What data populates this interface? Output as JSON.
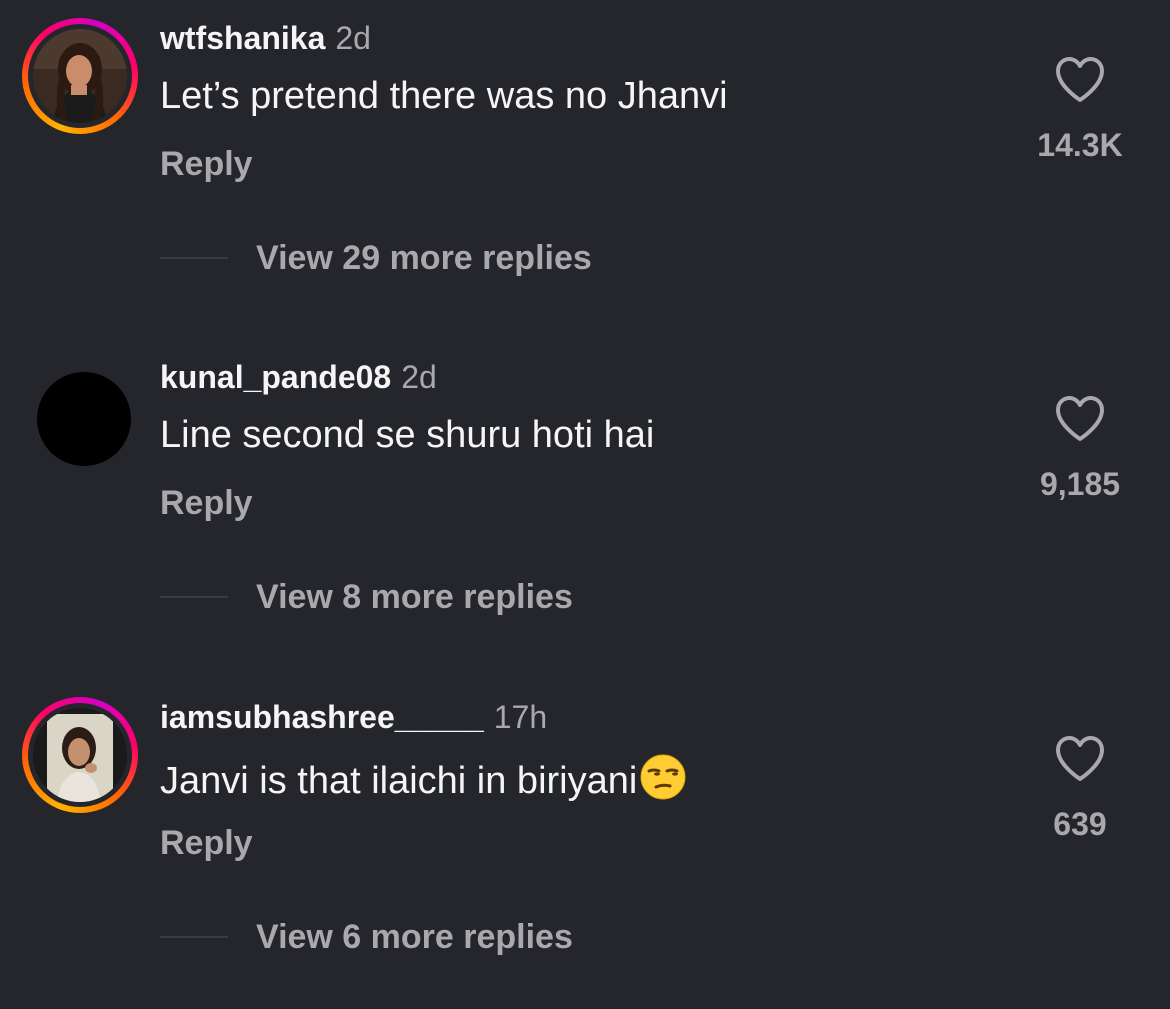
{
  "comments": [
    {
      "username": "wtfshanika",
      "time": "2d",
      "text": "Let’s pretend there was no Jhanvi",
      "reply_label": "Reply",
      "likes": "14.3K",
      "view_replies": "View 29 more replies",
      "has_story": true,
      "avatar": "user-photo"
    },
    {
      "username": "kunal_pande08",
      "time": "2d",
      "text": "Line second se shuru hoti hai",
      "reply_label": "Reply",
      "likes": "9,185",
      "view_replies": "View 8 more replies",
      "has_story": false,
      "avatar": "black-circle"
    },
    {
      "username": "iamsubhashree_____",
      "time": "17h",
      "text": "Janvi is that ilaichi in biriyani",
      "emoji": "unamused-face-emoji",
      "reply_label": "Reply",
      "likes": "639",
      "view_replies": "View 6 more replies",
      "has_story": true,
      "avatar": "user-photo"
    }
  ],
  "colors": {
    "background": "#25262b",
    "primary_text": "#f5f5f5",
    "secondary_text": "#a8a8ad",
    "story_ring": [
      "#ffb300",
      "#ff0069",
      "#d300c5"
    ]
  }
}
